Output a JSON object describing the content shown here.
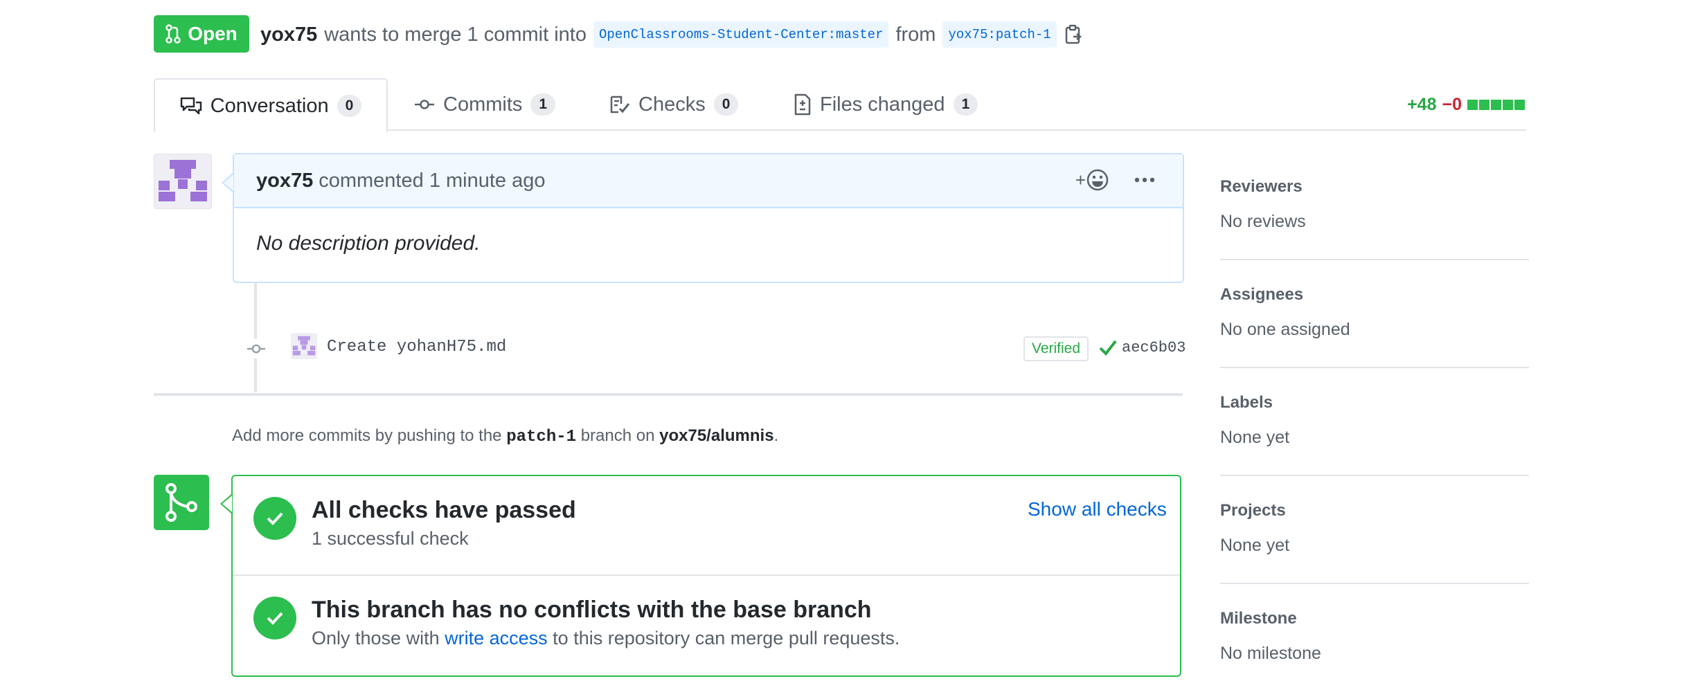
{
  "pr_header": {
    "state": "Open",
    "author": "yox75",
    "merge_text": "wants to merge 1 commit into",
    "base_ref": "OpenClassrooms-Student-Center:master",
    "from_text": "from",
    "head_ref": "yox75:patch-1"
  },
  "tabs": [
    {
      "label": "Conversation",
      "count": "0"
    },
    {
      "label": "Commits",
      "count": "1"
    },
    {
      "label": "Checks",
      "count": "0"
    },
    {
      "label": "Files changed",
      "count": "1"
    }
  ],
  "diffstat": {
    "additions": "+48",
    "deletions": "−0"
  },
  "comment": {
    "author": "yox75",
    "action": "commented",
    "time": "1 minute ago",
    "body": "No description provided.",
    "reaction_plus": "+"
  },
  "commit": {
    "message": "Create yohanH75.md",
    "verified": "Verified",
    "sha": "aec6b03"
  },
  "push_hint": {
    "prefix": "Add more commits by pushing to the",
    "branch": "patch-1",
    "middle": "branch on",
    "repo": "yox75/alumnis",
    "suffix": "."
  },
  "merge_box": {
    "checks_title": "All checks have passed",
    "checks_sub": "1 successful check",
    "show_checks": "Show all checks",
    "conflict_title": "This branch has no conflicts with the base branch",
    "conflict_sub_prefix": "Only those with",
    "conflict_sub_link": "write access",
    "conflict_sub_suffix": "to this repository can merge pull requests."
  },
  "sidebar": [
    {
      "heading": "Reviewers",
      "value": "No reviews"
    },
    {
      "heading": "Assignees",
      "value": "No one assigned"
    },
    {
      "heading": "Labels",
      "value": "None yet"
    },
    {
      "heading": "Projects",
      "value": "None yet"
    },
    {
      "heading": "Milestone",
      "value": "No milestone"
    }
  ],
  "colors": {
    "success": "#2cbe4e",
    "link": "#0366d6",
    "deletion": "#cb2431",
    "comment_header": "#f1f8ff"
  }
}
